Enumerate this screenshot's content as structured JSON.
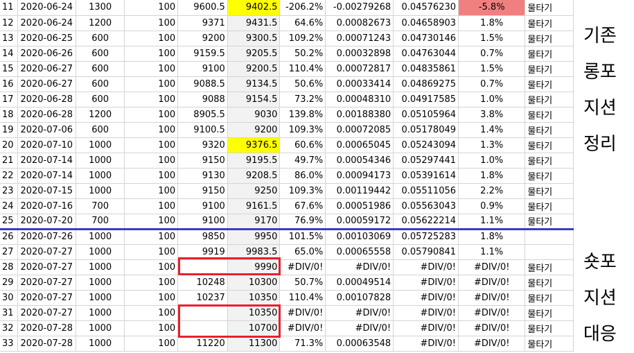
{
  "rows": [
    {
      "n": "11",
      "date": "2020-06-24",
      "qty": "1300",
      "c": "100",
      "d": "9600.5",
      "e": "9402.5",
      "f": "-206.2%",
      "g": "-0.00279268",
      "h": "0.04576230",
      "i": "-5.8%",
      "j": "물타기"
    },
    {
      "n": "12",
      "date": "2020-06-24",
      "qty": "1200",
      "c": "100",
      "d": "9371",
      "e": "9431.5",
      "f": "64.6%",
      "g": "0.00082673",
      "h": "0.04658903",
      "i": "1.8%",
      "j": "물타기"
    },
    {
      "n": "13",
      "date": "2020-06-25",
      "qty": "600",
      "c": "100",
      "d": "9200",
      "e": "9300.5",
      "f": "109.2%",
      "g": "0.00071243",
      "h": "0.04730146",
      "i": "1.5%",
      "j": "물타기"
    },
    {
      "n": "14",
      "date": "2020-06-26",
      "qty": "600",
      "c": "100",
      "d": "9159.5",
      "e": "9205.5",
      "f": "50.2%",
      "g": "0.00032898",
      "h": "0.04763044",
      "i": "0.7%",
      "j": "물타기"
    },
    {
      "n": "15",
      "date": "2020-06-27",
      "qty": "600",
      "c": "100",
      "d": "9100",
      "e": "9200.5",
      "f": "110.4%",
      "g": "0.00072817",
      "h": "0.04835861",
      "i": "1.5%",
      "j": "물타기"
    },
    {
      "n": "16",
      "date": "2020-06-27",
      "qty": "600",
      "c": "100",
      "d": "9088.5",
      "e": "9134.5",
      "f": "50.6%",
      "g": "0.00033414",
      "h": "0.04869275",
      "i": "0.7%",
      "j": "물타기"
    },
    {
      "n": "17",
      "date": "2020-06-28",
      "qty": "600",
      "c": "100",
      "d": "9088",
      "e": "9154.5",
      "f": "73.2%",
      "g": "0.00048310",
      "h": "0.04917585",
      "i": "1.0%",
      "j": "물타기"
    },
    {
      "n": "18",
      "date": "2020-06-28",
      "qty": "1200",
      "c": "100",
      "d": "8905.5",
      "e": "9030",
      "f": "139.8%",
      "g": "0.00188380",
      "h": "0.05105964",
      "i": "3.8%",
      "j": "물타기"
    },
    {
      "n": "19",
      "date": "2020-07-06",
      "qty": "600",
      "c": "100",
      "d": "9100.5",
      "e": "9200",
      "f": "109.3%",
      "g": "0.00072085",
      "h": "0.05178049",
      "i": "1.4%",
      "j": "물타기"
    },
    {
      "n": "20",
      "date": "2020-07-10",
      "qty": "1000",
      "c": "100",
      "d": "9320",
      "e": "9376.5",
      "f": "60.6%",
      "g": "0.00065045",
      "h": "0.05243094",
      "i": "1.3%",
      "j": "물타기"
    },
    {
      "n": "21",
      "date": "2020-07-14",
      "qty": "1000",
      "c": "100",
      "d": "9150",
      "e": "9195.5",
      "f": "49.7%",
      "g": "0.00054346",
      "h": "0.05297441",
      "i": "1.0%",
      "j": "물타기"
    },
    {
      "n": "22",
      "date": "2020-07-14",
      "qty": "1000",
      "c": "100",
      "d": "9130",
      "e": "9208.5",
      "f": "86.0%",
      "g": "0.00094173",
      "h": "0.05391614",
      "i": "1.8%",
      "j": "물타기"
    },
    {
      "n": "23",
      "date": "2020-07-15",
      "qty": "1000",
      "c": "100",
      "d": "9150",
      "e": "9250",
      "f": "109.3%",
      "g": "0.00119442",
      "h": "0.05511056",
      "i": "2.2%",
      "j": "물타기"
    },
    {
      "n": "24",
      "date": "2020-07-16",
      "qty": "700",
      "c": "100",
      "d": "9100",
      "e": "9161.5",
      "f": "67.6%",
      "g": "0.00051986",
      "h": "0.05563043",
      "i": "0.9%",
      "j": "물타기"
    },
    {
      "n": "25",
      "date": "2020-07-20",
      "qty": "700",
      "c": "100",
      "d": "9100",
      "e": "9170",
      "f": "76.9%",
      "g": "0.00059172",
      "h": "0.05622214",
      "i": "1.1%",
      "j": "물타기"
    },
    {
      "n": "26",
      "date": "2020-07-26",
      "qty": "1000",
      "c": "100",
      "d": "9850",
      "e": "9950",
      "f": "101.5%",
      "g": "0.00103069",
      "h": "0.05725283",
      "i": "1.8%",
      "j": ""
    },
    {
      "n": "27",
      "date": "2020-07-27",
      "qty": "1000",
      "c": "100",
      "d": "9919",
      "e": "9983.5",
      "f": "65.0%",
      "g": "0.00065558",
      "h": "0.05790841",
      "i": "1.1%",
      "j": ""
    },
    {
      "n": "28",
      "date": "2020-07-27",
      "qty": "1000",
      "c": "100",
      "d": "",
      "e": "9990",
      "f": "#DIV/0!",
      "g": "#DIV/0!",
      "h": "#DIV/0!",
      "i": "#DIV/0!",
      "j": "물타기"
    },
    {
      "n": "29",
      "date": "2020-07-27",
      "qty": "1000",
      "c": "100",
      "d": "10248",
      "e": "10300",
      "f": "50.7%",
      "g": "0.00049514",
      "h": "#DIV/0!",
      "i": "#DIV/0!",
      "j": "물타기"
    },
    {
      "n": "30",
      "date": "2020-07-27",
      "qty": "1000",
      "c": "100",
      "d": "10237",
      "e": "10350",
      "f": "110.4%",
      "g": "0.00107828",
      "h": "#DIV/0!",
      "i": "#DIV/0!",
      "j": "물타기"
    },
    {
      "n": "31",
      "date": "2020-07-27",
      "qty": "1000",
      "c": "100",
      "d": "",
      "e": "10350",
      "f": "#DIV/0!",
      "g": "#DIV/0!",
      "h": "#DIV/0!",
      "i": "#DIV/0!",
      "j": "물타기"
    },
    {
      "n": "32",
      "date": "2020-07-28",
      "qty": "1000",
      "c": "100",
      "d": "",
      "e": "10700",
      "f": "#DIV/0!",
      "g": "#DIV/0!",
      "h": "#DIV/0!",
      "i": "#DIV/0!",
      "j": "물타기"
    },
    {
      "n": "33",
      "date": "2020-07-28",
      "qty": "1000",
      "c": "100",
      "d": "11220",
      "e": "11300",
      "f": "71.3%",
      "g": "0.00063548",
      "h": "#DIV/0!",
      "i": "#DIV/0!",
      "j": "물타기"
    }
  ],
  "highlights": {
    "yellow_rows": [
      "11",
      "20"
    ],
    "negative_row": "11",
    "separator_after_row": "25",
    "yellow_color": "#ffff00",
    "negative_color": "#f08080",
    "separator_color": "#3b3bc6",
    "box_color": "#e8202a"
  },
  "side_labels": {
    "top": [
      "기존",
      "롱포",
      "지션",
      "정리"
    ],
    "bottom": [
      "숏포",
      "지션",
      "대응"
    ]
  }
}
